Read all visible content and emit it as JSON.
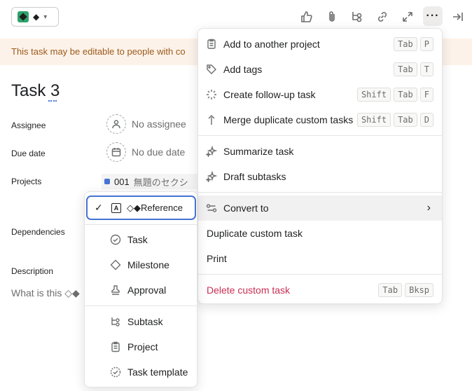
{
  "topbar": {
    "type_button": {
      "label": "◆",
      "icons": [
        "green-diamond-icon",
        "chevron-down-icon"
      ]
    },
    "tools": [
      "thumbs-up-icon",
      "paperclip-icon",
      "subtask-icon",
      "link-icon",
      "expand-icon",
      "more-icon",
      "close-panel-icon"
    ],
    "more_label": "···"
  },
  "banner": {
    "text": "This task may be editable to people with co"
  },
  "task": {
    "title": "Task 3"
  },
  "fields": {
    "assignee": {
      "label": "Assignee",
      "value": "No assignee"
    },
    "due_date": {
      "label": "Due date",
      "value": "No due date"
    },
    "projects": {
      "label": "Projects",
      "project_code": "001",
      "project_name": "無題のセクシ"
    },
    "dependencies": {
      "label": "Dependencies"
    },
    "description": {
      "label": "Description",
      "placeholder": "What is this ◇◆"
    }
  },
  "more_menu": {
    "items": [
      {
        "label": "Add to another project",
        "icon": "checklist-icon",
        "keys": [
          "Tab",
          "P"
        ]
      },
      {
        "label": "Add tags",
        "icon": "tag-icon",
        "keys": [
          "Tab",
          "T"
        ]
      },
      {
        "label": "Create follow-up task",
        "icon": "loading-icon",
        "keys": [
          "Shift",
          "Tab",
          "F"
        ]
      },
      {
        "label": "Merge duplicate custom tasks",
        "icon": "merge-icon",
        "keys": [
          "Shift",
          "Tab",
          "D"
        ]
      },
      {
        "label": "Summarize task",
        "icon": "sparkle-icon",
        "keys": []
      },
      {
        "label": "Draft subtasks",
        "icon": "sparkle-icon",
        "keys": []
      },
      {
        "label": "Convert to",
        "icon": "convert-icon",
        "keys": []
      },
      {
        "label": "Duplicate custom task",
        "keys": []
      },
      {
        "label": "Print",
        "keys": []
      },
      {
        "label": "Delete custom task",
        "keys": [
          "Tab",
          "Bksp"
        ]
      }
    ]
  },
  "convert_menu": {
    "selected": {
      "label": "◇◆Reference",
      "badge": "A"
    },
    "items": [
      {
        "label": "Task",
        "icon": "check-circle-icon"
      },
      {
        "label": "Milestone",
        "icon": "diamond-icon"
      },
      {
        "label": "Approval",
        "icon": "approval-icon"
      },
      {
        "label": "Subtask",
        "icon": "subtask-icon"
      },
      {
        "label": "Project",
        "icon": "clipboard-icon"
      },
      {
        "label": "Task template",
        "icon": "template-icon"
      }
    ]
  },
  "colors": {
    "accent": "#4573d2",
    "danger": "#c92f54",
    "banner_bg": "#fdf2e9",
    "banner_text": "#9b5a1a",
    "green": "#2fa36b"
  }
}
